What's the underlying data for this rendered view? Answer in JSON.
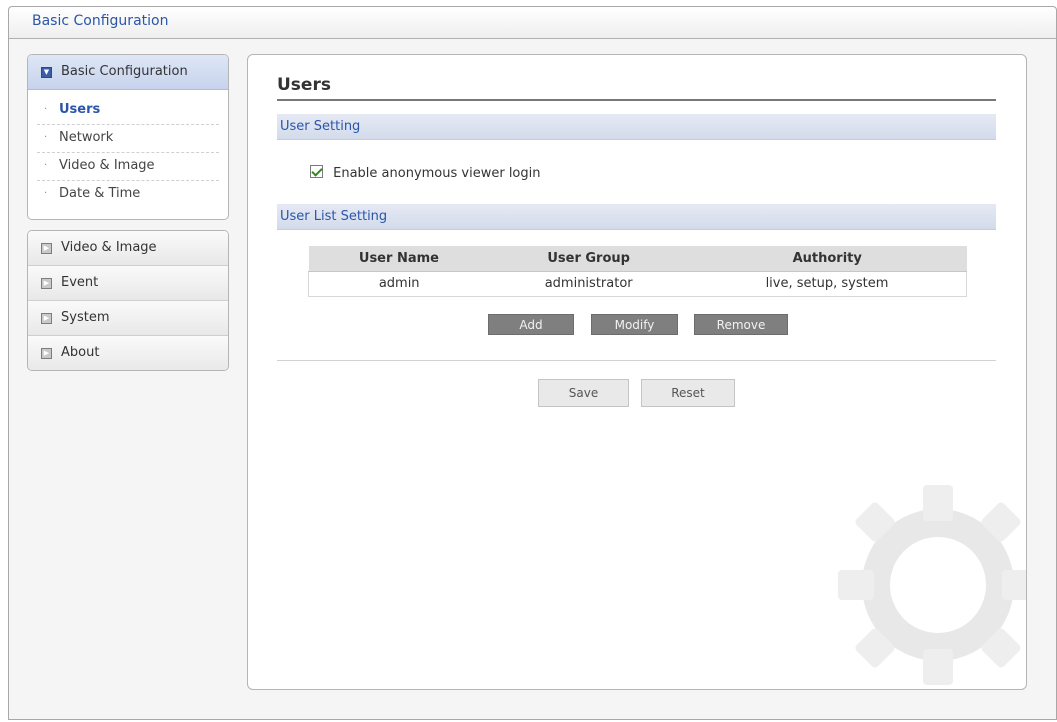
{
  "header": {
    "title": "Basic Configuration"
  },
  "sidebar": {
    "basic": {
      "label": "Basic Configuration",
      "items": [
        {
          "label": "Users",
          "active": true
        },
        {
          "label": "Network"
        },
        {
          "label": "Video & Image"
        },
        {
          "label": "Date & Time"
        }
      ]
    },
    "categories": [
      {
        "label": "Video & Image"
      },
      {
        "label": "Event"
      },
      {
        "label": "System"
      },
      {
        "label": "About"
      }
    ]
  },
  "main": {
    "title": "Users",
    "user_setting": {
      "heading": "User Setting",
      "anonymous_label": "Enable anonymous viewer login",
      "anonymous_checked": true
    },
    "user_list": {
      "heading": "User List Setting",
      "columns": [
        "User Name",
        "User Group",
        "Authority"
      ],
      "rows": [
        [
          "admin",
          "administrator",
          "live, setup, system"
        ]
      ],
      "buttons": {
        "add": "Add",
        "modify": "Modify",
        "remove": "Remove"
      }
    },
    "footer_buttons": {
      "save": "Save",
      "reset": "Reset"
    }
  },
  "colors": {
    "accent_blue": "#2b56a8",
    "checkmark_green": "#2e8b1e",
    "button_gray": "#7f7f7f"
  }
}
